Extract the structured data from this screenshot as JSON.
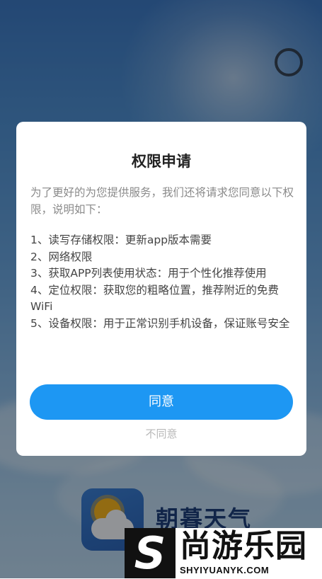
{
  "splash": {
    "app_name": "朝暮天气"
  },
  "dialog": {
    "title": "权限申请",
    "intro": "为了更好的为您提供服务，我们还将请求您同意以下权限，说明如下：",
    "permissions": [
      "1、读写存储权限：更新app版本需要",
      "2、网络权限",
      "3、获取APP列表使用状态：用于个性化推荐使用",
      "4、定位权限：获取您的粗略位置，推荐附近的免费WiFi",
      "5、设备权限：用于正常识别手机设备，保证账号安全"
    ],
    "agree_label": "同意",
    "disagree_label": "不同意"
  },
  "watermark": {
    "mark": "S",
    "name": "尚游乐园",
    "domain": "SHYIYUANYK.COM"
  },
  "colors": {
    "accent": "#1d97f3",
    "overlay": "rgba(0,0,0,0.40)",
    "dialog_bg": "#ffffff"
  },
  "icons": {
    "loading_ring": "loading-ring-icon",
    "app_logo": "sun-cloud-logo"
  }
}
